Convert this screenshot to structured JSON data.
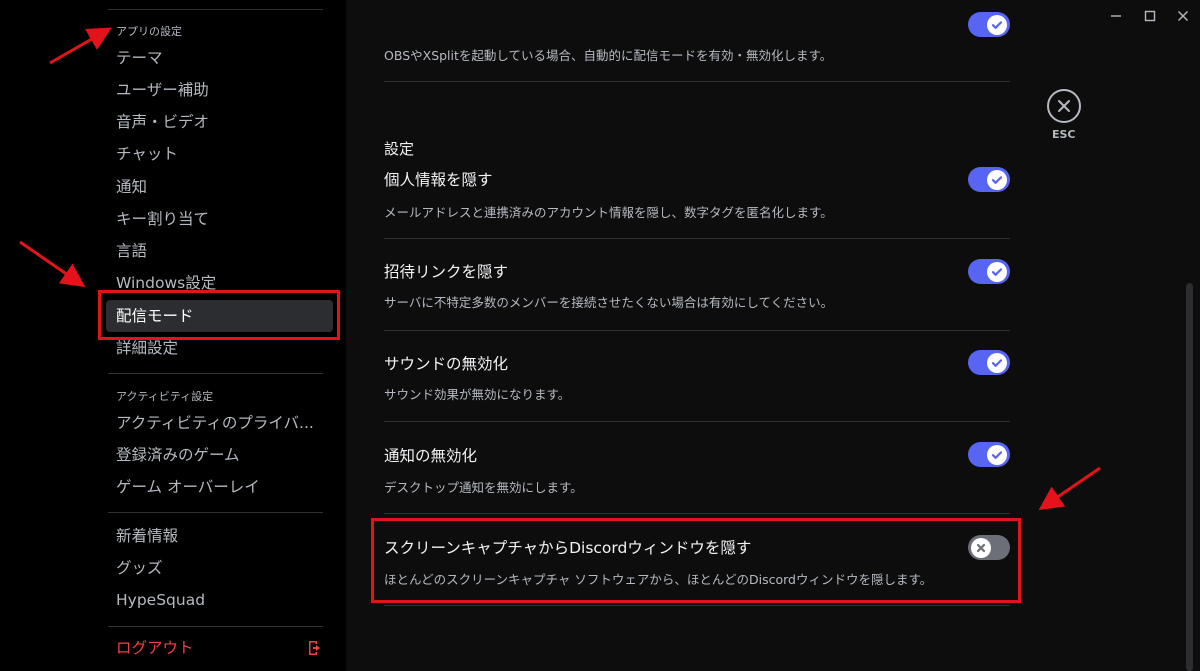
{
  "sidebar": {
    "app_settings_label": "アプリの設定",
    "items": [
      {
        "label": "テーマ"
      },
      {
        "label": "ユーザー補助"
      },
      {
        "label": "音声・ビデオ"
      },
      {
        "label": "チャット"
      },
      {
        "label": "通知"
      },
      {
        "label": "キー割り当て"
      },
      {
        "label": "言語"
      },
      {
        "label": "Windows設定"
      },
      {
        "label": "配信モード",
        "selected": true
      },
      {
        "label": "詳細設定"
      }
    ],
    "activity_settings_label": "アクティビティ設定",
    "activity_items": [
      {
        "label": "アクティビティのプライバ..."
      },
      {
        "label": "登録済みのゲーム"
      },
      {
        "label": "ゲーム オーバーレイ"
      }
    ],
    "misc_items": [
      {
        "label": "新着情報"
      },
      {
        "label": "グッズ"
      },
      {
        "label": "HypeSquad"
      }
    ],
    "logout_label": "ログアウト"
  },
  "main": {
    "top_desc": "OBSやXSplitを起動している場合、自動的に配信モードを有効・無効化します。",
    "section_label": "設定",
    "rows": [
      {
        "title": "個人情報を隠す",
        "desc": "メールアドレスと連携済みのアカウント情報を隠し、数字タグを匿名化します。",
        "enabled": true
      },
      {
        "title": "招待リンクを隠す",
        "desc": "サーバに不特定多数のメンバーを接続させたくない場合は有効にしてください。",
        "enabled": true
      },
      {
        "title": "サウンドの無効化",
        "desc": "サウンド効果が無効になります。",
        "enabled": true
      },
      {
        "title": "通知の無効化",
        "desc": "デスクトップ通知を無効にします。",
        "enabled": true
      },
      {
        "title": "スクリーンキャプチャからDiscordウィンドウを隠す",
        "desc": "ほとんどのスクリーンキャプチャ ソフトウェアから、ほとんどのDiscordウィンドウを隠します。",
        "enabled": false
      }
    ],
    "esc_label": "ESC"
  },
  "colors": {
    "accent": "#5865f2",
    "toggle_off": "#6d6f78",
    "danger": "#f23f43",
    "annotation": "#e4121a"
  }
}
